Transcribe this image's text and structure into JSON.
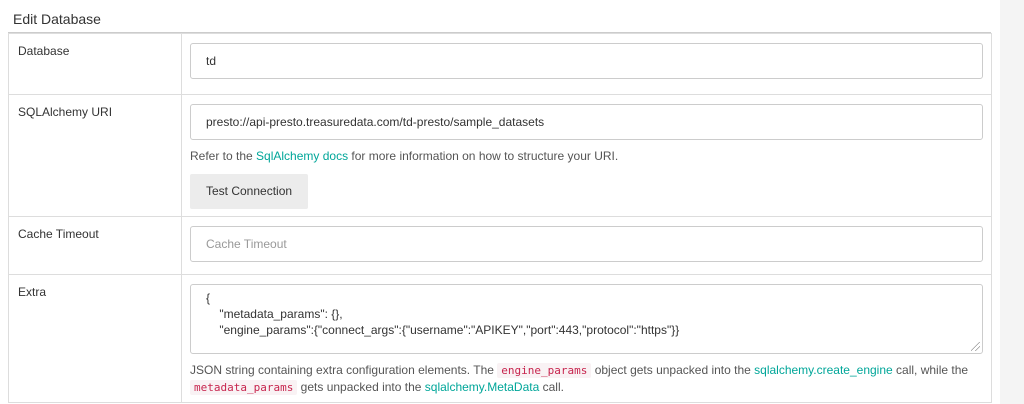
{
  "form": {
    "title": "Edit Database",
    "database": {
      "label": "Database",
      "value": "td"
    },
    "uri": {
      "label": "SQLAlchemy URI",
      "value": "presto://api-presto.treasuredata.com/td-presto/sample_datasets",
      "help_prefix": "Refer to the ",
      "help_link": "SqlAlchemy docs",
      "help_suffix": " for more information on how to structure your URI.",
      "test_button": "Test Connection"
    },
    "cache": {
      "label": "Cache Timeout",
      "placeholder": "Cache Timeout"
    },
    "extra": {
      "label": "Extra",
      "line1": "{",
      "line2": "    \"metadata_params\": {},",
      "line3": "    \"engine_params\":{\"connect_args\":{\"username\":\"APIKEY\",\"port\":443,\"protocol\":\"https\"}}",
      "help_1": "JSON string containing extra configuration elements. The ",
      "help_code1": "engine_params",
      "help_2": " object gets unpacked into the ",
      "help_link1": "sqlalchemy.create_engine",
      "help_3": " call, while the ",
      "help_code2": "metadata_params",
      "help_4": " gets unpacked into the ",
      "help_link2": "sqlalchemy.MetaData",
      "help_5": " call."
    }
  }
}
